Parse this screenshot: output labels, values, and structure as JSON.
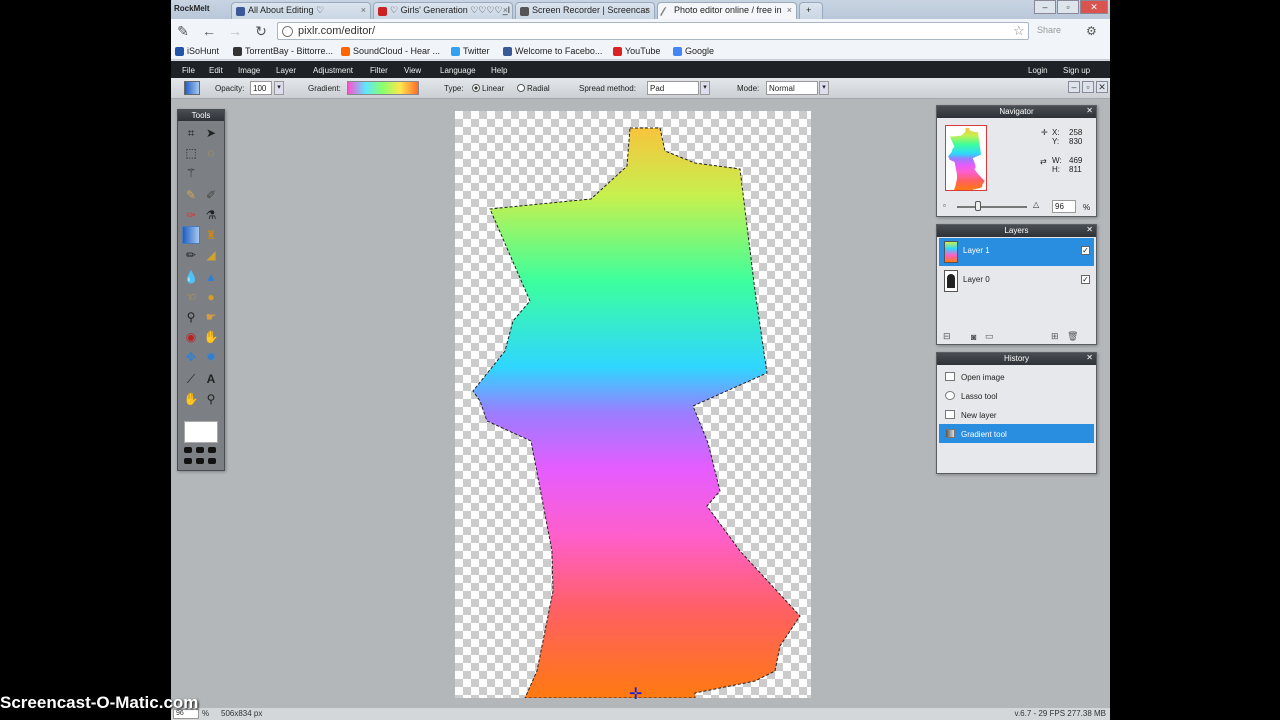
{
  "browser": {
    "brand": "RockMelt",
    "tabs": [
      {
        "label": "All About Editing ♡",
        "color": "#3b5998"
      },
      {
        "label": "♡ Girls' Generation ♡♡♡♡_I",
        "color": "#cc2222"
      },
      {
        "label": "Screen Recorder | Screencas",
        "color": "#555555"
      },
      {
        "label": "Photo editor online / free in",
        "color": "#888888"
      }
    ],
    "url": "pixlr.com/editor/",
    "share_label": "Share",
    "bookmarks": [
      {
        "label": "iSoHunt",
        "color": "#2255aa"
      },
      {
        "label": "TorrentBay - Bittorre...",
        "color": "#333333"
      },
      {
        "label": "SoundCloud - Hear ...",
        "color": "#ff6600"
      },
      {
        "label": "Twitter",
        "color": "#33a1f2"
      },
      {
        "label": "Welcome to Facebo...",
        "color": "#3b5998"
      },
      {
        "label": "YouTube",
        "color": "#dd2222"
      },
      {
        "label": "Google",
        "color": "#4285f4"
      }
    ]
  },
  "menu": {
    "items": [
      "File",
      "Edit",
      "Image",
      "Layer",
      "Adjustment",
      "Filter",
      "View",
      "Language",
      "Help"
    ],
    "login": "Login",
    "signup": "Sign up"
  },
  "options": {
    "opacity_label": "Opacity:",
    "opacity_value": "100",
    "gradient_label": "Gradient:",
    "type_label": "Type:",
    "type_linear": "Linear",
    "type_radial": "Radial",
    "spread_label": "Spread method:",
    "spread_value": "Pad",
    "mode_label": "Mode:",
    "mode_value": "Normal"
  },
  "tools_panel": {
    "title": "Tools"
  },
  "navigator": {
    "title": "Navigator",
    "x_label": "X:",
    "x_value": "258",
    "y_label": "Y:",
    "y_value": "830",
    "w_label": "W:",
    "w_value": "469",
    "h_label": "H:",
    "h_value": "811",
    "zoom_value": "96",
    "zoom_unit": "%"
  },
  "layers": {
    "title": "Layers",
    "items": [
      {
        "name": "Layer 1",
        "selected": true
      },
      {
        "name": "Layer 0",
        "selected": false
      }
    ]
  },
  "history": {
    "title": "History",
    "items": [
      "Open image",
      "Lasso tool",
      "New layer",
      "Gradient tool"
    ]
  },
  "status": {
    "zoom": "96",
    "zoom_unit": "%",
    "dimensions": "506x834 px",
    "version": "v.6.7 - 29 FPS 277.38 MB"
  },
  "watermark": "Screencast-O-Matic.com"
}
